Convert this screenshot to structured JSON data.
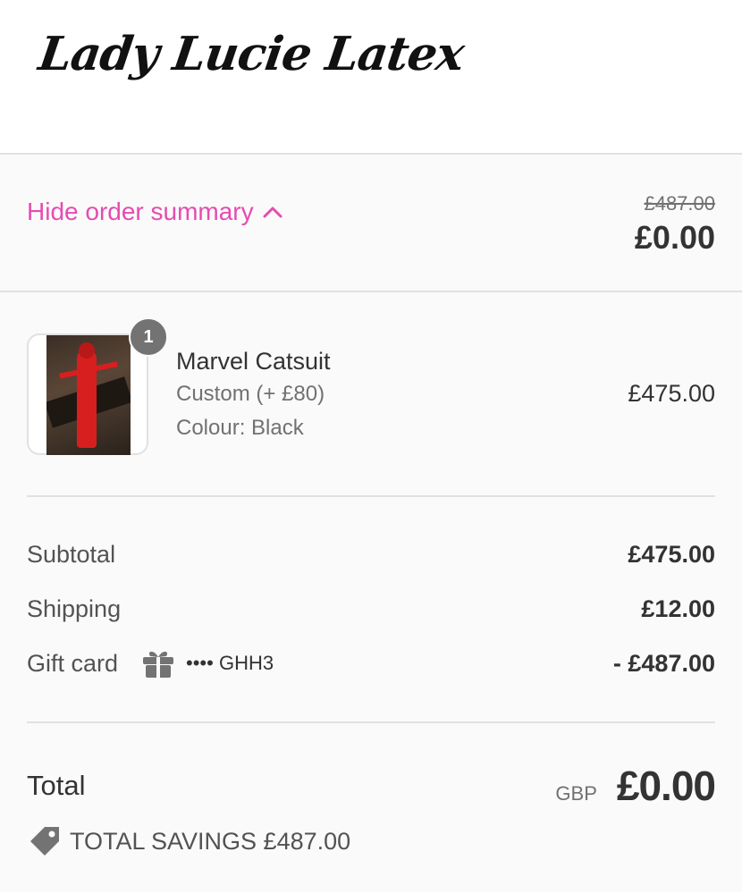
{
  "header": {
    "logo_text": "Lady Lucie Latex"
  },
  "summary_toggle": {
    "label": "Hide order summary",
    "original_price": "£487.00",
    "total": "£0.00",
    "accent_color": "#e54cb0"
  },
  "line_items": [
    {
      "quantity": "1",
      "name": "Marvel Catsuit",
      "variant": "Custom (+ £80)",
      "colour": "Colour: Black",
      "price": "£475.00"
    }
  ],
  "costs": {
    "subtotal_label": "Subtotal",
    "subtotal_value": "£475.00",
    "shipping_label": "Shipping",
    "shipping_value": "£12.00",
    "gift_card_label": "Gift card",
    "gift_card_code": "•••• GHH3",
    "gift_card_value": "- £487.00"
  },
  "total": {
    "label": "Total",
    "currency": "GBP",
    "amount": "£0.00"
  },
  "savings": {
    "text": "TOTAL SAVINGS £487.00"
  },
  "icons": {
    "toggle": "chevron-up-icon",
    "gift": "gift-icon",
    "savings": "tag-icon"
  }
}
